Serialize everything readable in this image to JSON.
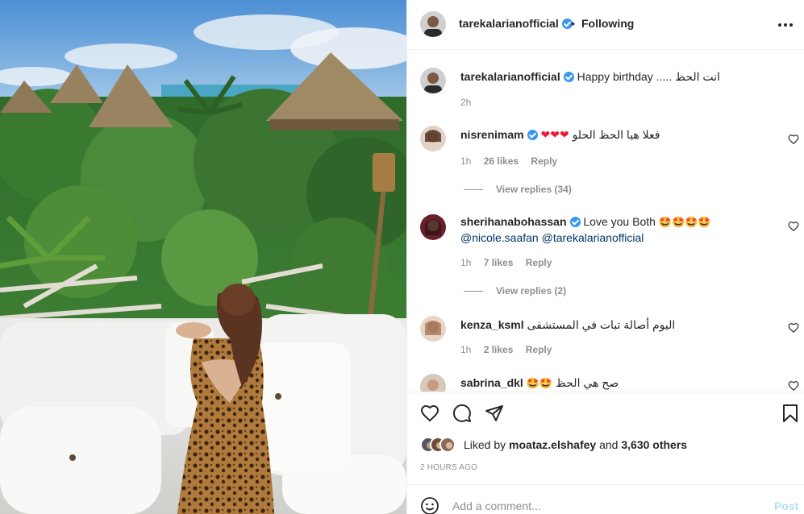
{
  "header": {
    "username": "tarekalarianofficial",
    "separator": "•",
    "follow_status": "Following",
    "more_icon": "more-horizontal-icon"
  },
  "caption": {
    "username": "tarekalarianofficial",
    "text": "Happy birthday ..... انت الحظ",
    "time": "2h"
  },
  "comments": [
    {
      "username": "nisrenimam",
      "verified": true,
      "text": "فعلا هيا الحظ الحلو",
      "hearts": "❤❤❤",
      "time": "1h",
      "likes": "26 likes",
      "reply": "Reply",
      "view_replies": "View replies (34)"
    },
    {
      "username": "sherihanabohassan",
      "verified": true,
      "text": "Love you Both",
      "emojis": "🤩🤩🤩🤩",
      "mention1": "@nicole.saafan",
      "mention2": "@tarekalarianofficial",
      "time": "1h",
      "likes": "7 likes",
      "reply": "Reply",
      "view_replies": "View replies (2)"
    },
    {
      "username": "kenza_ksml",
      "verified": false,
      "text": "اليوم أصالة تبات في المستشفى",
      "time": "1h",
      "likes": "2 likes",
      "reply": "Reply"
    },
    {
      "username": "sabrina_dkl",
      "verified": false,
      "emojis": "🤩🤩",
      "text": "صح هي الحظ"
    }
  ],
  "actions": {
    "like_icon": "heart-icon",
    "comment_icon": "comment-icon",
    "share_icon": "paper-plane-icon",
    "save_icon": "bookmark-icon"
  },
  "likes": {
    "prefix": "Liked by",
    "user": "moataz.elshafey",
    "middle": "and",
    "others": "3,630 others"
  },
  "timestamp": "2 HOURS AGO",
  "add_comment": {
    "placeholder": "Add a comment...",
    "post_label": "Post"
  },
  "colors": {
    "accent": "#3897f0",
    "post_disabled": "#b2dffc",
    "muted": "#8e8e8e",
    "mention": "#00376b",
    "heart": "#ed1a3b"
  }
}
